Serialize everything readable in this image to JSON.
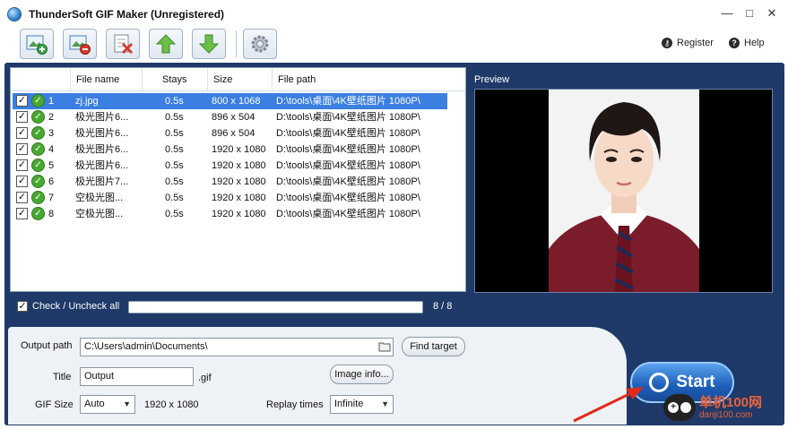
{
  "window": {
    "title": "ThunderSoft GIF Maker (Unregistered)",
    "controls": [
      "—",
      "□",
      "✕"
    ]
  },
  "toolbar": {
    "buttons": [
      {
        "name": "add-image-icon",
        "color": "#3aa34a"
      },
      {
        "name": "remove-image-icon",
        "color": "#d23b2c"
      },
      {
        "name": "clear-list-icon",
        "color": "#d23b2c"
      },
      {
        "name": "move-up-icon",
        "color": "#3aa34a"
      },
      {
        "name": "move-down-icon",
        "color": "#3aa34a"
      },
      {
        "name": "settings-gear-icon",
        "color": "#8a95a3"
      }
    ],
    "register_label": "Register",
    "help_label": "Help"
  },
  "file_list": {
    "columns": [
      "File name",
      "Stays",
      "Size",
      "File path"
    ],
    "rows": [
      {
        "num": "1",
        "name": "zj.jpg",
        "stays": "0.5s",
        "size": "800 x 1068",
        "path": "D:\\tools\\桌面\\4K壁纸图片 1080P\\",
        "selected": true
      },
      {
        "num": "2",
        "name": "极光图片6...",
        "stays": "0.5s",
        "size": "896 x 504",
        "path": "D:\\tools\\桌面\\4K壁纸图片 1080P\\",
        "selected": false
      },
      {
        "num": "3",
        "name": "极光图片6...",
        "stays": "0.5s",
        "size": "896 x 504",
        "path": "D:\\tools\\桌面\\4K壁纸图片 1080P\\",
        "selected": false
      },
      {
        "num": "4",
        "name": "极光图片6...",
        "stays": "0.5s",
        "size": "1920 x 1080",
        "path": "D:\\tools\\桌面\\4K壁纸图片 1080P\\",
        "selected": false
      },
      {
        "num": "5",
        "name": "极光图片6...",
        "stays": "0.5s",
        "size": "1920 x 1080",
        "path": "D:\\tools\\桌面\\4K壁纸图片 1080P\\",
        "selected": false
      },
      {
        "num": "6",
        "name": "极光图片7...",
        "stays": "0.5s",
        "size": "1920 x 1080",
        "path": "D:\\tools\\桌面\\4K壁纸图片 1080P\\",
        "selected": false
      },
      {
        "num": "7",
        "name": "空极光图...",
        "stays": "0.5s",
        "size": "1920 x 1080",
        "path": "D:\\tools\\桌面\\4K壁纸图片 1080P\\",
        "selected": false
      },
      {
        "num": "8",
        "name": "空极光图...",
        "stays": "0.5s",
        "size": "1920 x 1080",
        "path": "D:\\tools\\桌面\\4K壁纸图片 1080P\\",
        "selected": false
      }
    ]
  },
  "preview": {
    "label": "Preview"
  },
  "check_all": {
    "label": "Check / Uncheck all",
    "checked": true
  },
  "progress": {
    "text": "8 / 8",
    "fraction": 1.0
  },
  "output": {
    "path_label": "Output path",
    "path_value": "C:\\Users\\admin\\Documents\\",
    "find_target_label": "Find target",
    "title_label": "Title",
    "title_value": "Output",
    "extension": ".gif",
    "image_info_label": "Image info...",
    "gif_size_label": "GIF Size",
    "gif_size_value": "Auto",
    "gif_size_dims": "1920 x 1080",
    "replay_label": "Replay times",
    "replay_value": "Infinite"
  },
  "start": {
    "label": "Start"
  },
  "watermark": {
    "cn": "单机100网",
    "url": "danji100.com"
  }
}
